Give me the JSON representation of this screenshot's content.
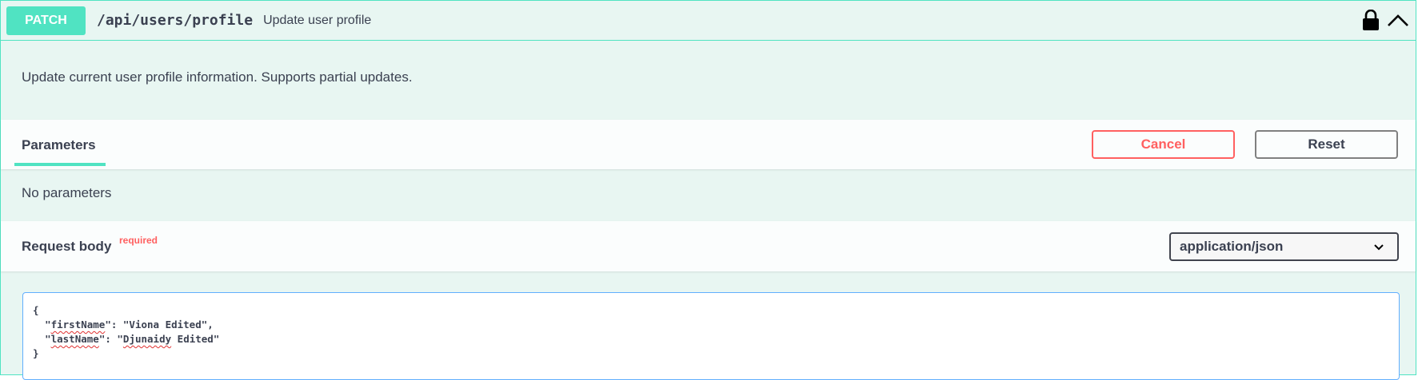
{
  "operation": {
    "method": "PATCH",
    "path": "/api/users/profile",
    "summary": "Update user profile",
    "description": "Update current user profile information. Supports partial updates.",
    "method_color": "#50e3c2",
    "icons": {
      "lock": "lock-icon",
      "collapse": "chevron-up-icon"
    }
  },
  "parameters": {
    "tab_label": "Parameters",
    "cancel_label": "Cancel",
    "reset_label": "Reset",
    "empty_text": "No parameters"
  },
  "request_body": {
    "title": "Request body",
    "required_label": "required",
    "content_type": "application/json",
    "editor": {
      "open_brace": "{",
      "line1": {
        "indent": "  ",
        "quote_open": "\"",
        "key": "firstName",
        "rest": "\": \"Viona Edited\","
      },
      "line2": {
        "indent": "  ",
        "quote_open": "\"",
        "key": "lastName",
        "rest_a": "\": \"",
        "word": "Djunaidy",
        "rest_b": " Edited\""
      },
      "close_brace": "}"
    }
  }
}
